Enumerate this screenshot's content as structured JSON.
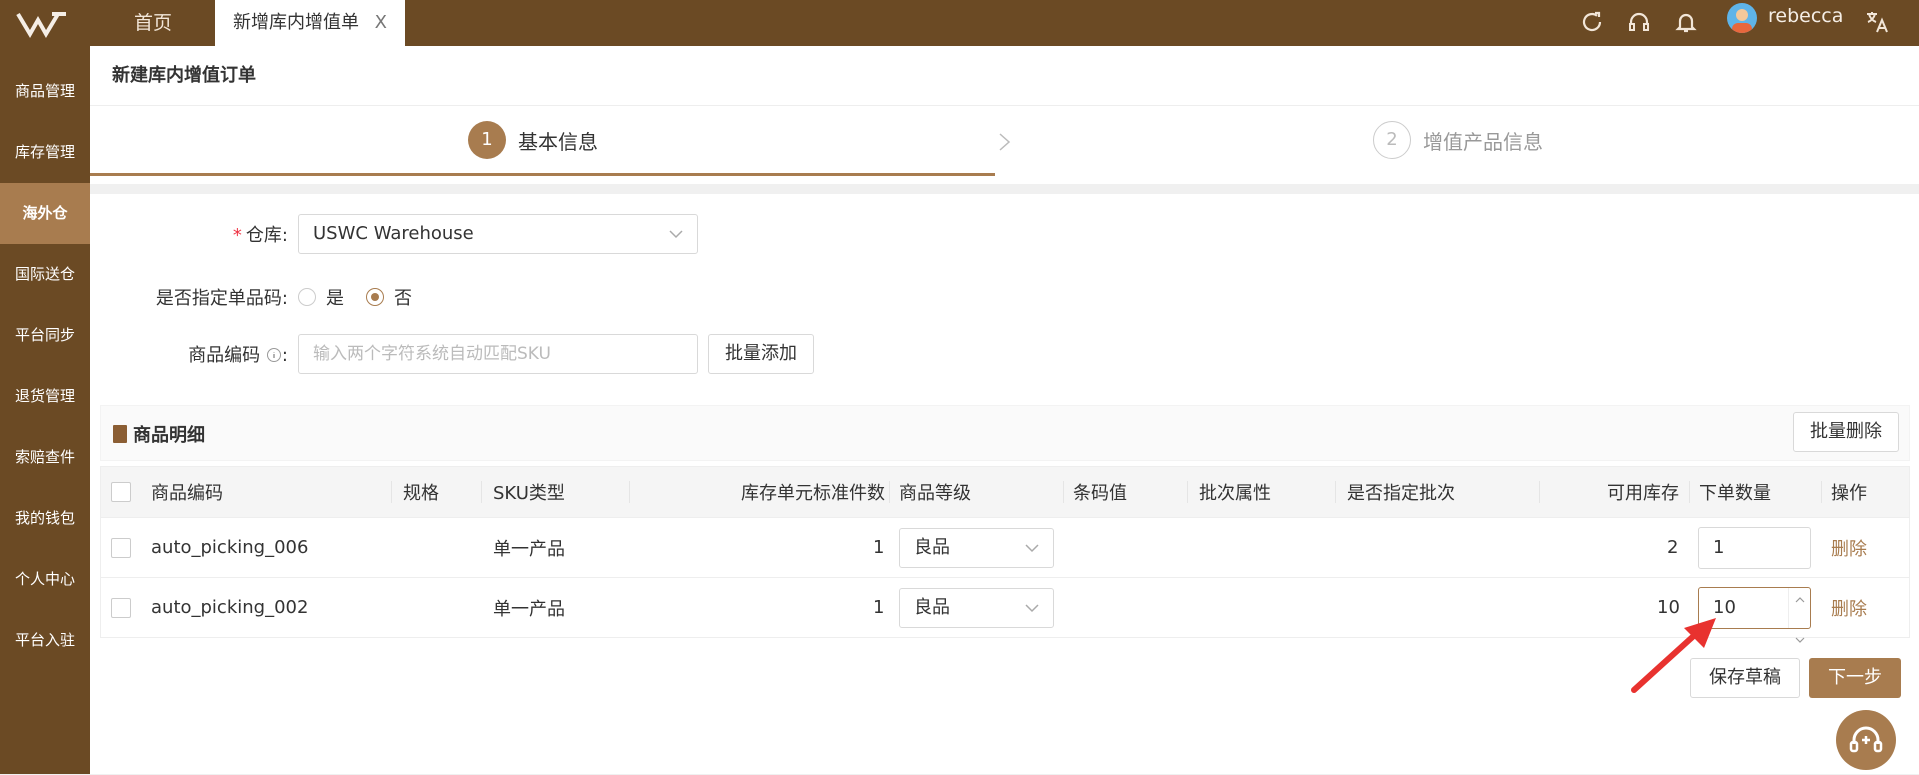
{
  "topbar": {
    "home_tab": "首页",
    "active_tab": "新增库内增值单",
    "close_glyph": "X",
    "username": "rebecca",
    "icons": [
      "refresh-icon",
      "headset-icon",
      "bell-icon",
      "user-avatar",
      "translate-icon"
    ]
  },
  "sidebar": {
    "items": [
      {
        "label": "商品管理"
      },
      {
        "label": "库存管理"
      },
      {
        "label": "海外仓",
        "active": true
      },
      {
        "label": "国际送仓"
      },
      {
        "label": "平台同步"
      },
      {
        "label": "退货管理"
      },
      {
        "label": "索赔查件"
      },
      {
        "label": "我的钱包"
      },
      {
        "label": "个人中心"
      },
      {
        "label": "平台入驻"
      }
    ]
  },
  "page": {
    "title": "新建库内增值订单",
    "steps": [
      {
        "num": "1",
        "label": "基本信息",
        "active": true
      },
      {
        "num": "2",
        "label": "增值产品信息",
        "active": false
      }
    ]
  },
  "form": {
    "warehouse_label": "仓库:",
    "warehouse_required": "*",
    "warehouse_value": "USWC Warehouse",
    "specify_label": "是否指定单品码:",
    "specify_yes": "是",
    "specify_no": "否",
    "sku_label": "商品编码",
    "sku_placeholder": "输入两个字符系统自动匹配SKU",
    "bulk_add": "批量添加"
  },
  "details": {
    "title": "商品明细",
    "bulk_delete": "批量删除",
    "columns": [
      "商品编码",
      "规格",
      "SKU类型",
      "库存单元标准件数",
      "商品等级",
      "条码值",
      "批次属性",
      "是否指定批次",
      "可用库存",
      "下单数量",
      "操作"
    ],
    "rows": [
      {
        "code": "auto_picking_006",
        "spec": "",
        "sku_type": "单一产品",
        "std_units": "1",
        "grade": "良品",
        "available": "2",
        "qty": "1",
        "op": "删除"
      },
      {
        "code": "auto_picking_002",
        "spec": "",
        "sku_type": "单一产品",
        "std_units": "1",
        "grade": "良品",
        "available": "10",
        "qty": "10",
        "op": "删除"
      }
    ]
  },
  "footer": {
    "save_draft": "保存草稿",
    "next": "下一步"
  },
  "colors": {
    "brand": "#6b4a24",
    "accent": "#a87c4f",
    "arrow": "#e8322f"
  }
}
